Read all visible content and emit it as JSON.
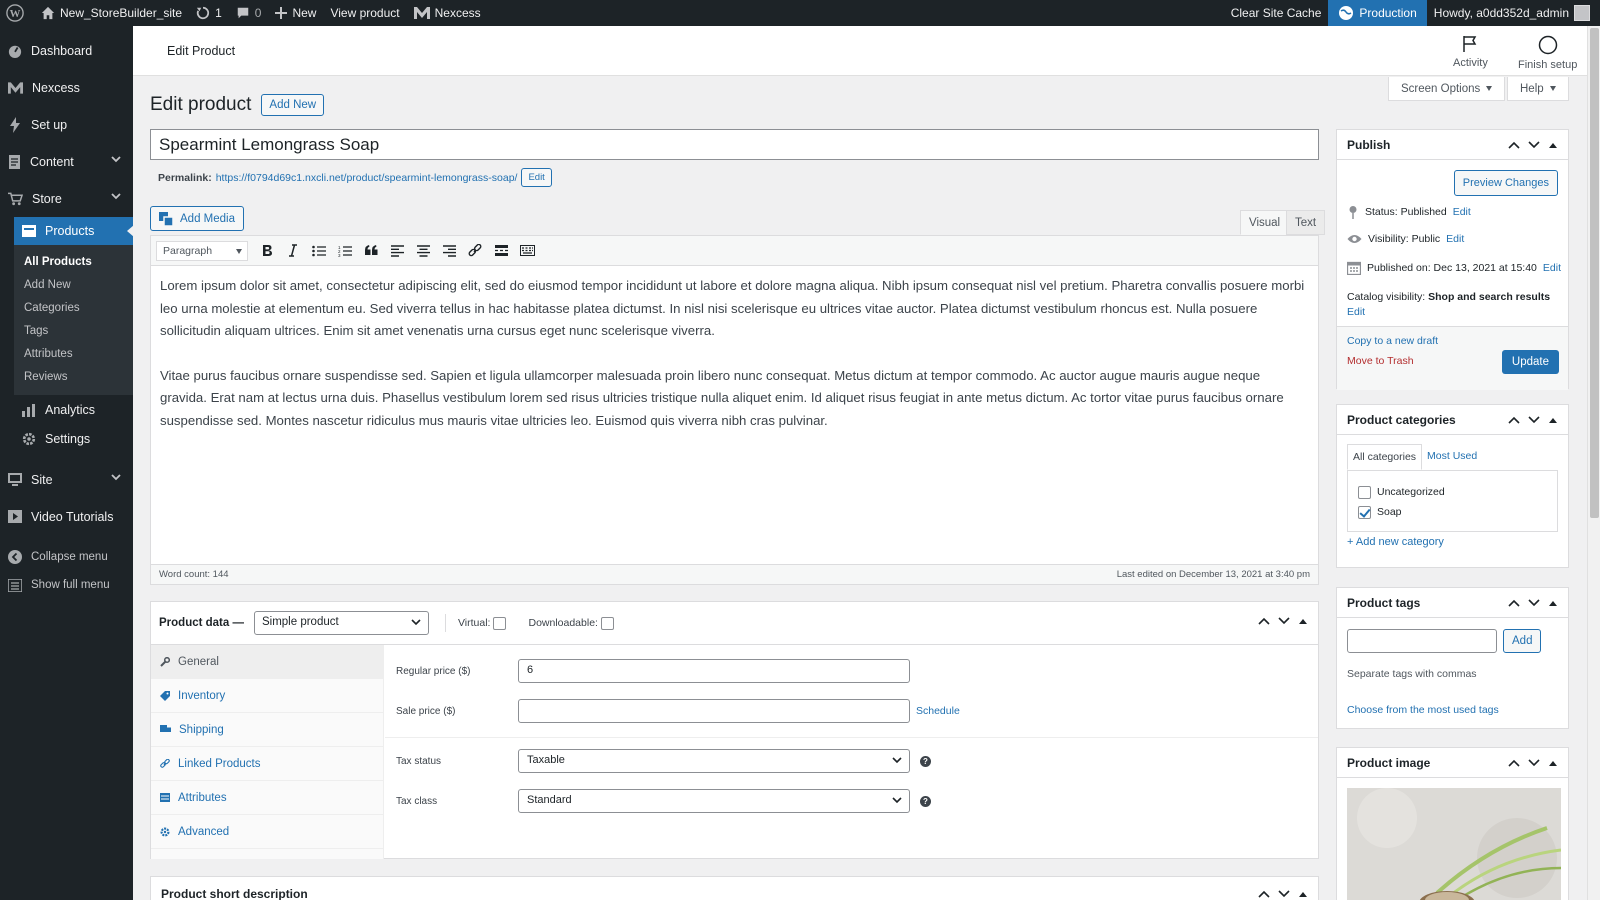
{
  "adminbar": {
    "site_name": "New_StoreBuilder_site",
    "updates_count": "1",
    "comments_count": "0",
    "new_label": "New",
    "view_product": "View product",
    "nexcess": "Nexcess",
    "clear_cache": "Clear Site Cache",
    "environment": "Production",
    "howdy": "Howdy, a0dd352d_admin"
  },
  "menu": {
    "dashboard": "Dashboard",
    "nexcess": "Nexcess",
    "setup": "Set up",
    "content": "Content",
    "store": "Store",
    "products": "Products",
    "submenu": [
      "All Products",
      "Add New",
      "Categories",
      "Tags",
      "Attributes",
      "Reviews"
    ],
    "analytics": "Analytics",
    "settings": "Settings",
    "site": "Site",
    "video_tutorials": "Video Tutorials",
    "collapse": "Collapse menu",
    "show_full": "Show full menu"
  },
  "header": {
    "title": "Edit Product",
    "activity": "Activity",
    "finish_setup": "Finish setup",
    "screen_options": "Screen Options",
    "help": "Help"
  },
  "main": {
    "heading": "Edit product",
    "add_new": "Add New",
    "product_title": "Spearmint Lemongrass Soap",
    "permalink_label": "Permalink:",
    "permalink_url": "https://f0794d69c1.nxcli.net/product/spearmint-lemongrass-soap/",
    "permalink_edit": "Edit",
    "add_media": "Add Media",
    "tab_visual": "Visual",
    "tab_text": "Text",
    "format_select": "Paragraph",
    "paragraph1": "Lorem ipsum dolor sit amet, consectetur adipiscing elit, sed do eiusmod tempor incididunt ut labore et dolore magna aliqua. Nibh ipsum consequat nisl vel pretium. Pharetra convallis posuere morbi leo urna molestie at elementum eu. Sed viverra tellus in hac habitasse platea dictumst. In nisl nisi scelerisque eu ultrices vitae auctor. Platea dictumst vestibulum rhoncus est. Nulla posuere sollicitudin aliquam ultrices. Enim sit amet venenatis urna cursus eget nunc scelerisque viverra.",
    "paragraph2": "Vitae purus faucibus ornare suspendisse sed. Sapien et ligula ullamcorper malesuada proin libero nunc consequat. Metus dictum at tempor commodo. Ac auctor augue mauris augue neque gravida. Erat nam at lectus urna duis. Phasellus vestibulum lorem sed risus ultricies tristique nulla aliquet enim. Id aliquet risus feugiat in ante metus dictum. Ac tortor vitae purus faucibus ornare suspendisse sed. Montes nascetur ridiculus mus mauris vitae ultricies leo. Euismod quis viverra nibh cras pulvinar.",
    "word_count": "Word count: 144",
    "last_edited": "Last edited on December 13, 2021 at 3:40 pm"
  },
  "product_data": {
    "label": "Product data —",
    "type": "Simple product",
    "virtual": "Virtual:",
    "downloadable": "Downloadable:",
    "tabs": [
      "General",
      "Inventory",
      "Shipping",
      "Linked Products",
      "Attributes",
      "Advanced"
    ],
    "regular_price_label": "Regular price ($)",
    "regular_price": "6",
    "sale_price_label": "Sale price ($)",
    "sale_price": "",
    "schedule": "Schedule",
    "tax_status_label": "Tax status",
    "tax_status": "Taxable",
    "tax_class_label": "Tax class",
    "tax_class": "Standard",
    "help_glyph": "?"
  },
  "short_description": {
    "title": "Product short description"
  },
  "publish": {
    "title": "Publish",
    "preview": "Preview Changes",
    "status": "Status: Published",
    "visibility": "Visibility: Public",
    "published_on": "Published on: Dec 13, 2021 at 15:40",
    "edit": "Edit",
    "catalog_label": "Catalog visibility:",
    "catalog_value": "Shop and search results",
    "copy_draft": "Copy to a new draft",
    "trash": "Move to Trash",
    "update": "Update"
  },
  "categories": {
    "title": "Product categories",
    "tab_all": "All categories",
    "tab_most": "Most Used",
    "items": [
      "Uncategorized",
      "Soap"
    ],
    "add_new": "+ Add new category"
  },
  "tags": {
    "title": "Product tags",
    "add": "Add",
    "hint": "Separate tags with commas",
    "choose": "Choose from the most used tags"
  },
  "image": {
    "title": "Product image"
  },
  "colors": {
    "accent": "#2271b1",
    "menu_bg": "#1d2327",
    "trash": "#b32d2e"
  }
}
